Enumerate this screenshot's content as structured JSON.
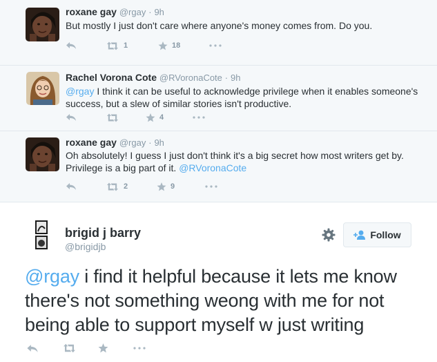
{
  "replies": [
    {
      "name": "roxane gay",
      "handle": "@rgay",
      "time": "9h",
      "mention": "",
      "text": "But mostly I just don't care where anyone's money comes from. Do you.",
      "mention_after": "",
      "retweets": "1",
      "favorites": "18"
    },
    {
      "name": "Rachel Vorona Cote",
      "handle": "@RVoronaCote",
      "time": "9h",
      "mention": "@rgay",
      "text": " I think it can be useful to acknowledge privilege when it enables someone's success, but a slew of similar stories isn't productive.",
      "mention_after": "",
      "retweets": "",
      "favorites": "4"
    },
    {
      "name": "roxane gay",
      "handle": "@rgay",
      "time": "9h",
      "mention": "",
      "text": "Oh absolutely! I guess I just don't think it's a big secret how most writers get by. Privilege is a big part of it. ",
      "mention_after": "@RVoronaCote",
      "retweets": "2",
      "favorites": "9"
    }
  ],
  "main": {
    "name": "brigid j barry",
    "handle": "@brigidjb",
    "follow_label": "Follow",
    "mention": "@rgay",
    "text": " i find it helpful because it lets me know there's not something weong with me for not being able to support myself w just writing"
  },
  "icons": {
    "reply": "reply-icon",
    "retweet": "retweet-icon",
    "favorite": "star-icon",
    "more": "more-icon",
    "gear": "gear-icon",
    "follow": "follow-icon"
  },
  "colors": {
    "link": "#55acee",
    "action_icon": "#aab8c2",
    "name": "#292f33",
    "meta": "#8899a6"
  }
}
